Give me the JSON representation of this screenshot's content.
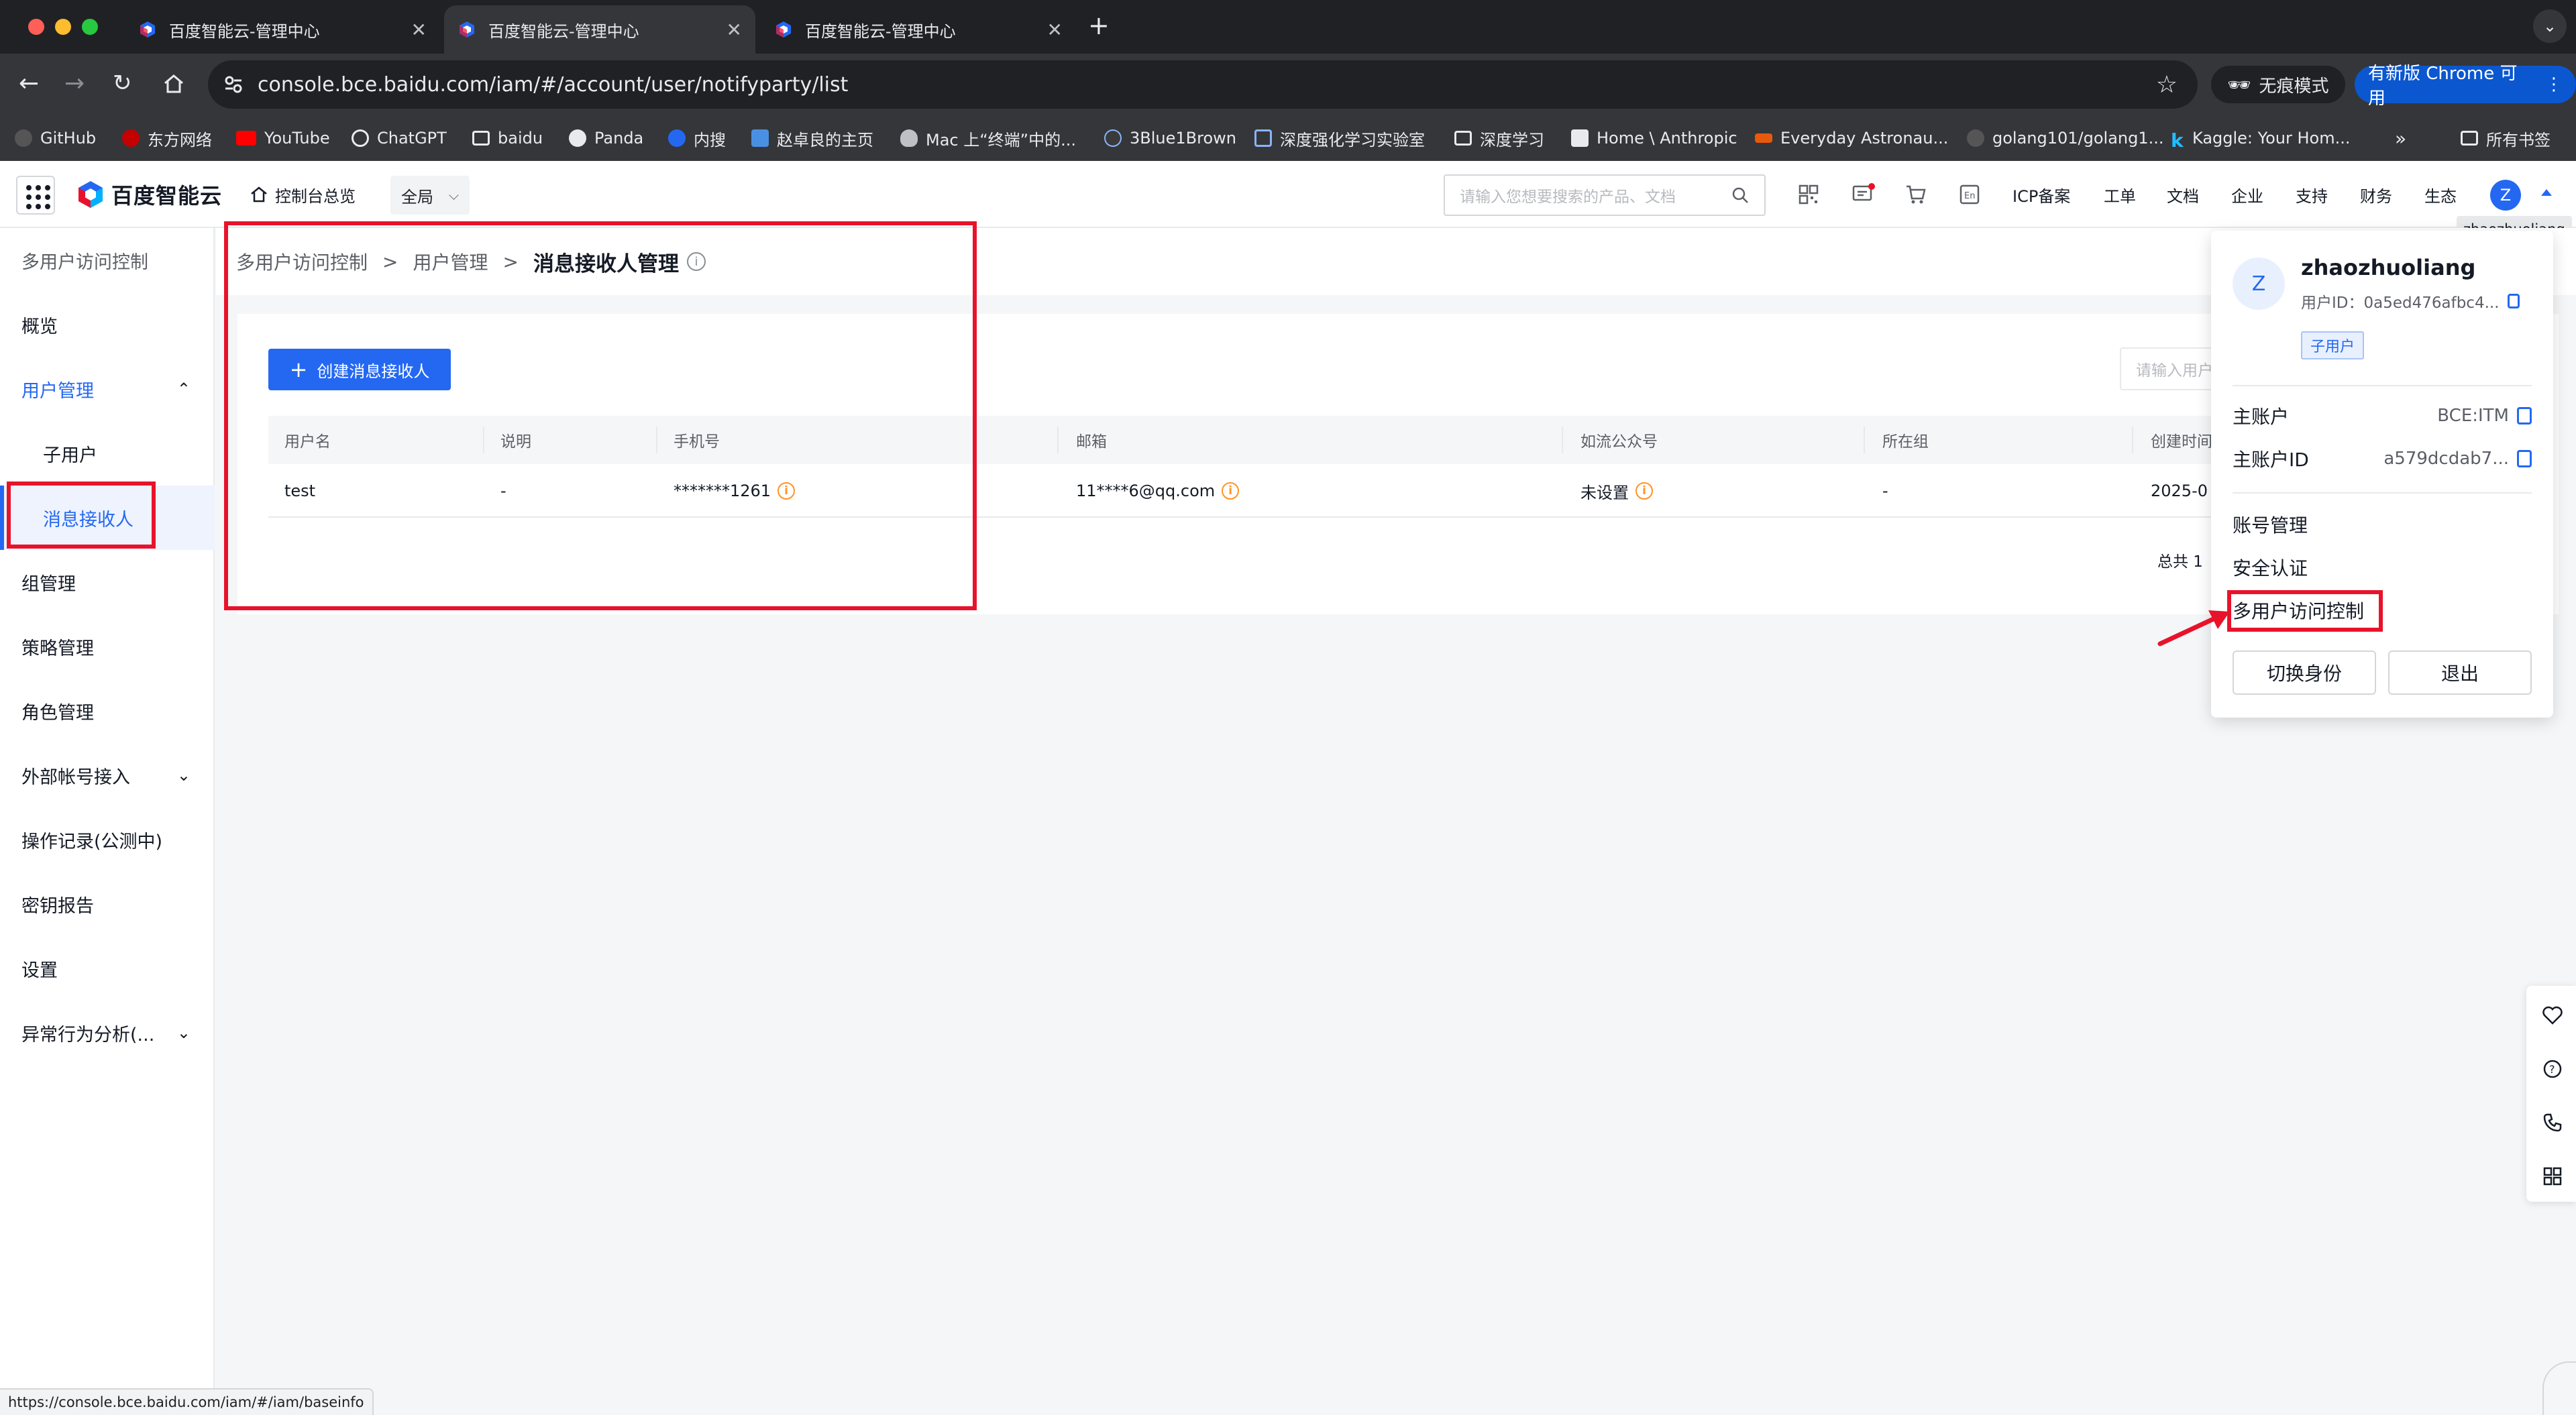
{
  "browser": {
    "tabs": [
      {
        "title": "百度智能云-管理中心"
      },
      {
        "title": "百度智能云-管理中心"
      },
      {
        "title": "百度智能云-管理中心"
      }
    ],
    "url": "console.bce.baidu.com/iam/#/account/user/notifyparty/list",
    "incognito_label": "无痕模式",
    "update_label": "有新版 Chrome 可用",
    "bookmarks": [
      "GitHub",
      "东方网络",
      "YouTube",
      "ChatGPT",
      "baidu",
      "Panda",
      "内搜",
      "赵卓良的主页",
      "Mac 上“终端”中的...",
      "3Blue1Brown",
      "深度强化学习实验室",
      "深度学习",
      "Home \\ Anthropic",
      "Everyday Astronau...",
      "golang101/golang1...",
      "Kaggle: Your Hom..."
    ],
    "all_bookmarks": "所有书签",
    "status_url": "https://console.bce.baidu.com/iam/#/iam/baseinfo"
  },
  "header": {
    "logo": "百度智能云",
    "overview": "控制台总览",
    "region": "全局",
    "search_placeholder": "请输入您想要搜索的产品、文档",
    "nav": [
      "ICP备案",
      "工单",
      "文档",
      "企业",
      "支持",
      "财务",
      "生态"
    ],
    "avatar": "Z",
    "username_tooltip": "zhaozhuoliang"
  },
  "sidebar": {
    "title": "多用户访问控制",
    "items": [
      {
        "label": "概览"
      },
      {
        "label": "用户管理"
      },
      {
        "label": "子用户"
      },
      {
        "label": "消息接收人"
      },
      {
        "label": "组管理"
      },
      {
        "label": "策略管理"
      },
      {
        "label": "角色管理"
      },
      {
        "label": "外部帐号接入"
      },
      {
        "label": "操作记录(公测中)"
      },
      {
        "label": "密钥报告"
      },
      {
        "label": "设置"
      },
      {
        "label": "异常行为分析(..."
      }
    ]
  },
  "breadcrumb": {
    "b1": "多用户访问控制",
    "b2": "用户管理",
    "current": "消息接收人管理"
  },
  "main": {
    "create_button": "创建消息接收人",
    "search_placeholder": "请输入用户",
    "columns": [
      "用户名",
      "说明",
      "手机号",
      "邮箱",
      "如流公众号",
      "所在组",
      "创建时间"
    ],
    "rows": [
      {
        "username": "test",
        "desc": "-",
        "phone": "*******1261",
        "email": "11****6@qq.com",
        "ruliu": "未设置",
        "group": "-",
        "created": "2025-0"
      }
    ],
    "total": "总共 1"
  },
  "popup": {
    "avatar": "Z",
    "name": "zhaozhuoliang",
    "user_id": "用户ID：0a5ed476afbc4...",
    "badge": "子用户",
    "main_account_label": "主账户",
    "main_account_value": "BCE:ITM",
    "main_account_id_label": "主账户ID",
    "main_account_id_value": "a579dcdab7...",
    "menu": [
      "账号管理",
      "安全认证",
      "多用户访问控制"
    ],
    "switch_button": "切换身份",
    "logout_button": "退出"
  }
}
